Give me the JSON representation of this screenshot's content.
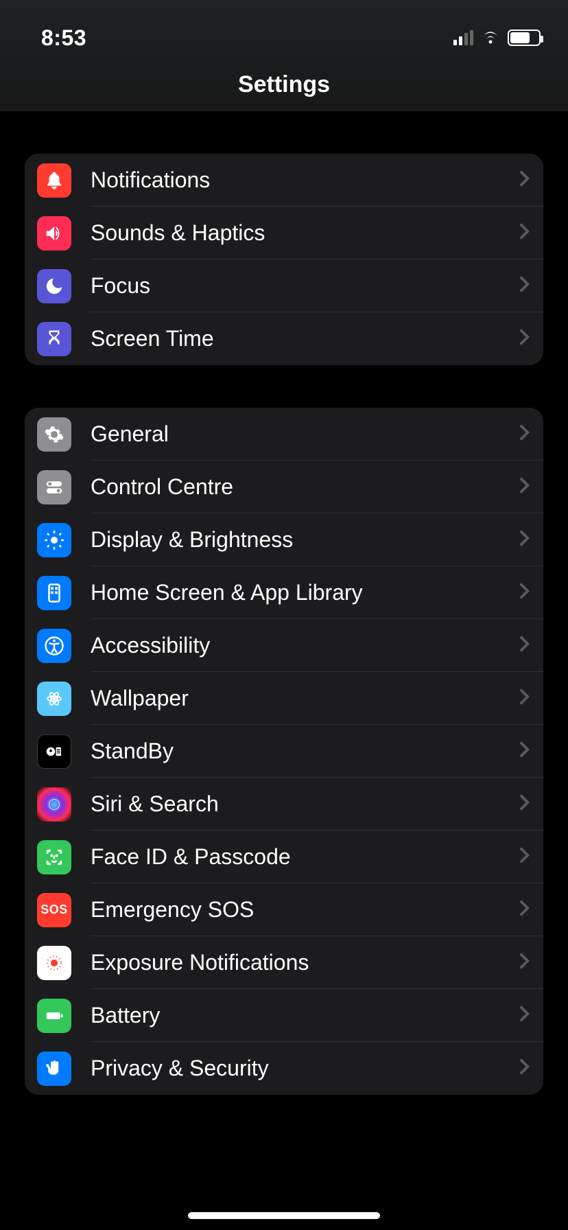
{
  "status": {
    "time": "8:53"
  },
  "header": {
    "title": "Settings"
  },
  "groups": [
    {
      "items": [
        {
          "label": "Notifications",
          "icon": "bell-icon",
          "bg": "bg-red"
        },
        {
          "label": "Sounds & Haptics",
          "icon": "speaker-icon",
          "bg": "bg-pink"
        },
        {
          "label": "Focus",
          "icon": "moon-icon",
          "bg": "bg-indigo"
        },
        {
          "label": "Screen Time",
          "icon": "hourglass-icon",
          "bg": "bg-indigo"
        }
      ]
    },
    {
      "items": [
        {
          "label": "General",
          "icon": "gear-icon",
          "bg": "bg-grey"
        },
        {
          "label": "Control Centre",
          "icon": "toggles-icon",
          "bg": "bg-grey"
        },
        {
          "label": "Display & Brightness",
          "icon": "sun-icon",
          "bg": "bg-blue"
        },
        {
          "label": "Home Screen & App Library",
          "icon": "grid-icon",
          "bg": "bg-blue"
        },
        {
          "label": "Accessibility",
          "icon": "accessibility-icon",
          "bg": "bg-blue"
        },
        {
          "label": "Wallpaper",
          "icon": "flower-icon",
          "bg": "bg-cyan"
        },
        {
          "label": "StandBy",
          "icon": "standby-icon",
          "bg": "bg-black"
        },
        {
          "label": "Siri & Search",
          "icon": "siri-icon",
          "bg": "bg-siri"
        },
        {
          "label": "Face ID & Passcode",
          "icon": "faceid-icon",
          "bg": "bg-green"
        },
        {
          "label": "Emergency SOS",
          "icon": "sos-icon",
          "bg": "bg-sos"
        },
        {
          "label": "Exposure Notifications",
          "icon": "exposure-icon",
          "bg": "bg-white"
        },
        {
          "label": "Battery",
          "icon": "battery-icon",
          "bg": "bg-green"
        },
        {
          "label": "Privacy & Security",
          "icon": "hand-icon",
          "bg": "bg-blue"
        }
      ]
    }
  ]
}
